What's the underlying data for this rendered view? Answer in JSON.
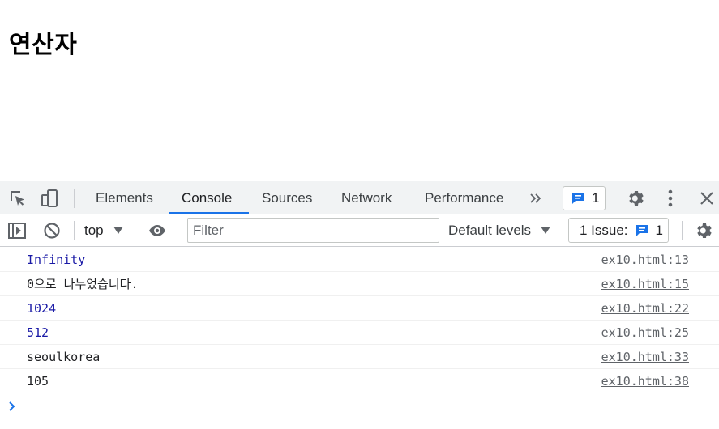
{
  "page": {
    "heading": "연산자"
  },
  "devtools": {
    "tabs": [
      {
        "label": "Elements",
        "active": false
      },
      {
        "label": "Console",
        "active": true
      },
      {
        "label": "Sources",
        "active": false
      },
      {
        "label": "Network",
        "active": false
      },
      {
        "label": "Performance",
        "active": false
      }
    ],
    "more_tabs_icon": "double-chevron-right-icon",
    "message_count": "1",
    "accent_color": "#1a73e8"
  },
  "toolbar": {
    "context": "top",
    "filter_placeholder": "Filter",
    "levels_label": "Default levels",
    "issues_label": "1 Issue:",
    "issues_count": "1"
  },
  "console": {
    "messages": [
      {
        "text": "Infinity",
        "kind": "number",
        "source": "ex10.html:13"
      },
      {
        "text": "0으로 나누었습니다.",
        "kind": "string",
        "source": "ex10.html:15"
      },
      {
        "text": "1024",
        "kind": "number",
        "source": "ex10.html:22"
      },
      {
        "text": "512",
        "kind": "number",
        "source": "ex10.html:25"
      },
      {
        "text": "seoulkorea",
        "kind": "string",
        "source": "ex10.html:33"
      },
      {
        "text": "105",
        "kind": "string",
        "source": "ex10.html:38"
      }
    ]
  }
}
